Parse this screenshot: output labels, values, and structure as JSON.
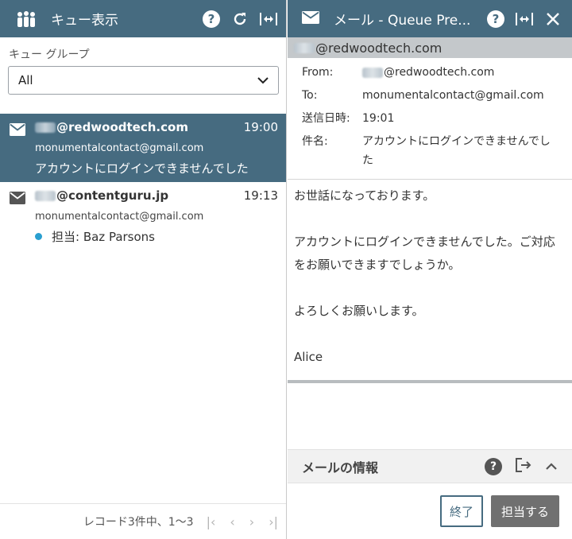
{
  "queue_panel": {
    "title": "キュー表示",
    "group_label": "キュー グループ",
    "group_selected": "All",
    "items": [
      {
        "from": "@redwoodtech.com",
        "time": "19:00",
        "to": "monumentalcontact@gmail.com",
        "subject": "アカウントにログインできませんでした",
        "selected": true
      },
      {
        "from": "@contentguru.jp",
        "time": "19:13",
        "to": "monumentalcontact@gmail.com",
        "assignee": "担当: Baz Parsons",
        "selected": false
      }
    ],
    "records_text": "レコード3件中、1〜3"
  },
  "mail_panel": {
    "title": "メール - Queue Pre...",
    "sender": "@redwoodtech.com",
    "from_label": "From:",
    "from_value": "@redwoodtech.com",
    "to_label": "To:",
    "to_value": "monumentalcontact@gmail.com",
    "sent_label": "送信日時:",
    "sent_value": "19:01",
    "subject_label": "件名:",
    "subject_value": "アカウントにログインできませんでした",
    "body": {
      "line1": "お世話になっております。",
      "line2": "アカウントにログインできませんでした。ご対応をお願いできますでしょうか。",
      "line3": "よろしくお願いします。",
      "line4": "Alice"
    },
    "info_title": "メールの情報",
    "end_button": "終了",
    "assign_button": "担当する"
  },
  "colors": {
    "header": "#466b80",
    "dot": "#2a9fd0",
    "assign_button": "#707070"
  }
}
